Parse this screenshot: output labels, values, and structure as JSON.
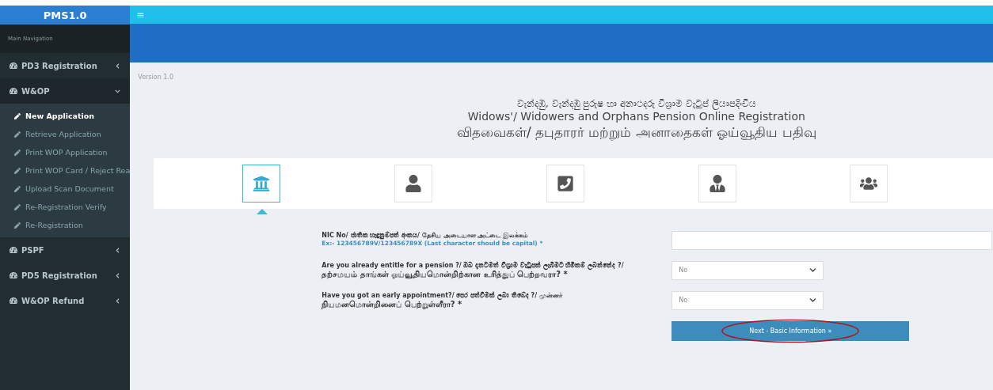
{
  "brand": "PMS1.0",
  "sidebar": {
    "search_placeholder": "Main Navigation",
    "items": [
      {
        "label": "PD3 Registration",
        "expanded": false
      },
      {
        "label": "W&OP",
        "expanded": true,
        "children": [
          {
            "label": "New Application",
            "selected": true
          },
          {
            "label": "Retrieve Application",
            "selected": false
          },
          {
            "label": "Print WOP Application",
            "selected": false
          },
          {
            "label": "Print WOP Card / Reject Rea",
            "selected": false
          },
          {
            "label": "Upload Scan Document",
            "selected": false
          },
          {
            "label": "Re-Registration Verify",
            "selected": false
          },
          {
            "label": "Re-Registration",
            "selected": false
          }
        ]
      },
      {
        "label": "PSPF",
        "expanded": false
      },
      {
        "label": "PD5 Registration",
        "expanded": false
      },
      {
        "label": "W&OP Refund",
        "expanded": false
      }
    ]
  },
  "menu_toggle": "≡",
  "version": "Version 1.0",
  "titles": [
    "වැන්දඹු, වැන්දඹු පුරුෂ හා අනාථදරු විශ්‍රාම වැටුප් ලියාපදිංචිය",
    "Widows'/ Widowers and Orphans Pension Online Registration",
    "விதவைகள்/ தபுதாரர் மற்றும் அனாதைகள் ஓய்வூதிய பதிவு"
  ],
  "steps": [
    {
      "kind": "bank",
      "selected": true
    },
    {
      "kind": "user",
      "selected": false
    },
    {
      "kind": "phone",
      "selected": false
    },
    {
      "kind": "officer",
      "selected": false
    },
    {
      "kind": "group",
      "selected": false
    }
  ],
  "form": [
    {
      "kind": "text",
      "label": "NIC No/ ජාතික හැඳුනුම්පත් අංකය/ தேசிய அடையாள அட்டை இலக்கம்",
      "hint": "Ex:- 123456789V/123456789X (Last character should be capital) *"
    },
    {
      "kind": "select",
      "label": "Are you already entitle for a pension ?/ ඔබ දැනටමත් විශ්‍රාම වැටුපක් ලැබීමට හිමිකම් ලබන්නේද ?/",
      "label_2": "தற்சமயம் தாங்கள் ஓய்வூதியமொன்றிற்கான உரித்துப் பெற்றவரா? *",
      "value": "No"
    },
    {
      "kind": "select",
      "label": "Have you got an early appointment?/ පෙර පත්වීමක් ලබා තිබේද ?/ முன்னர்",
      "label_2": "நியமனமொன்றினைப் பெற்றுள்ளீரா? *",
      "value": "No"
    }
  ],
  "next_button": {
    "label": "Next - Basic Information »",
    "highlighted": true
  }
}
